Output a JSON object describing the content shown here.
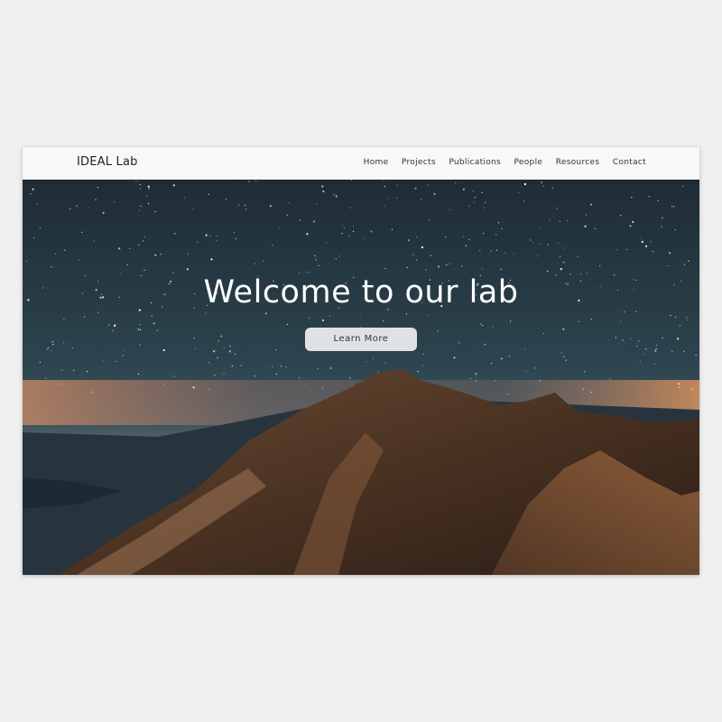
{
  "navbar": {
    "brand": "IDEAL Lab",
    "links": [
      {
        "label": "Home"
      },
      {
        "label": "Projects"
      },
      {
        "label": "Publications"
      },
      {
        "label": "People"
      },
      {
        "label": "Resources"
      },
      {
        "label": "Contact"
      }
    ]
  },
  "hero": {
    "title": "Welcome to our lab",
    "button_label": "Learn More",
    "background_image": "night-sky-mountain-photo"
  },
  "colors": {
    "page_background": "#efefef",
    "navbar_background": "#f8f8f8",
    "sky_top": "#23313b",
    "sky_mid": "#2f4a55",
    "horizon_glow": "#c9855a",
    "mountain": "#5a3b26",
    "button_background": "#dfe1e3"
  }
}
